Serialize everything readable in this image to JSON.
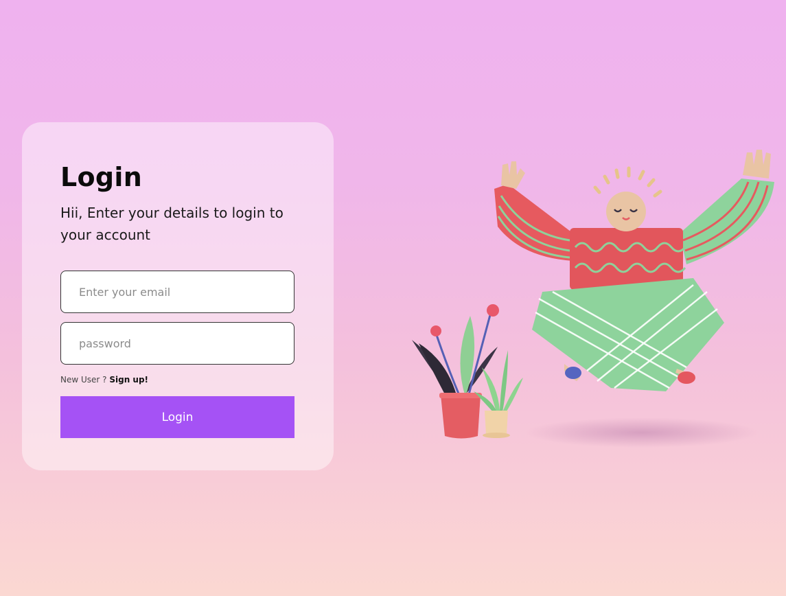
{
  "login_card": {
    "title": "Login",
    "subtitle": "Hii, Enter your details to login to your account",
    "email_placeholder": "Enter your email",
    "password_placeholder": "password",
    "signup_prompt": "New User ? ",
    "signup_link": "Sign up!",
    "login_button": "Login"
  },
  "colors": {
    "accent": "#a552f5",
    "background_top": "#efb2ef",
    "background_bottom": "#fbd8d2"
  },
  "illustration": {
    "name": "meditating-clay-character-with-plants"
  }
}
